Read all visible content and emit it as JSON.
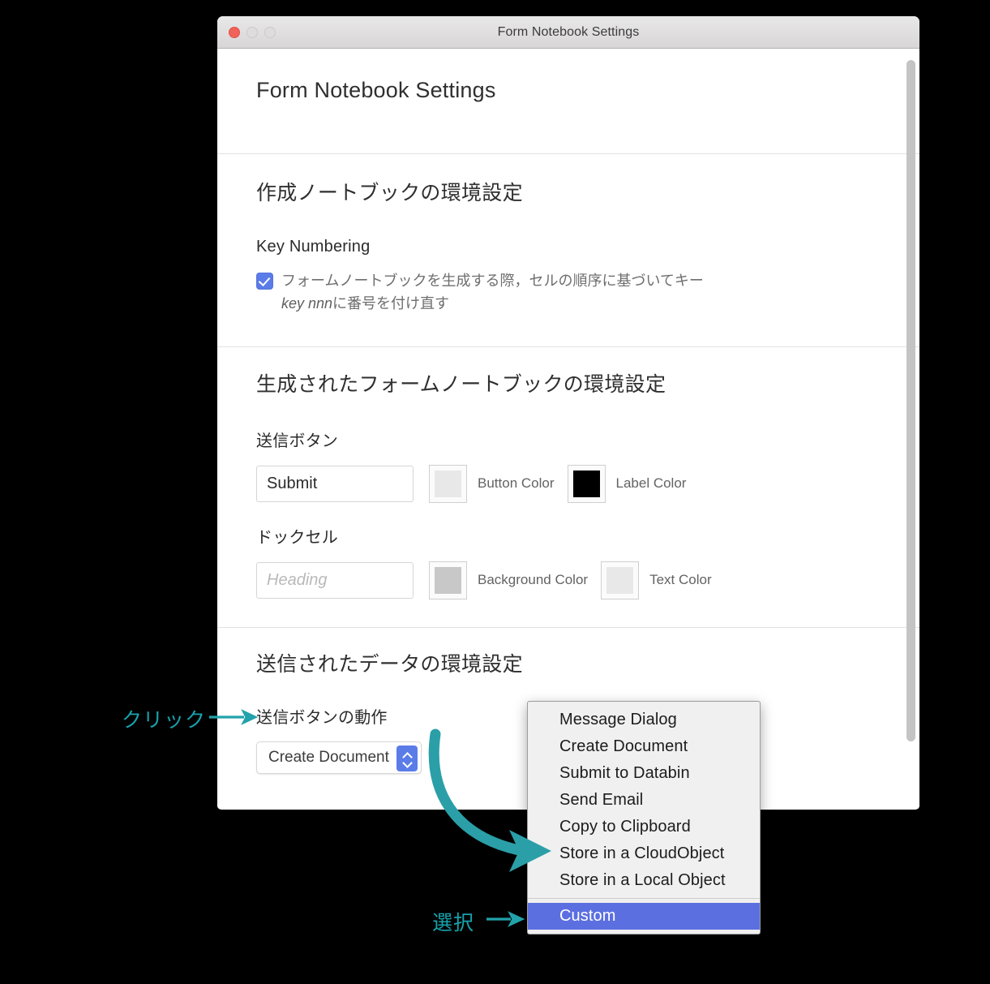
{
  "window": {
    "title": "Form Notebook Settings",
    "traffic_lights": [
      "close",
      "minimize",
      "zoom"
    ]
  },
  "page": {
    "title": "Form Notebook Settings"
  },
  "sections": [
    {
      "heading": "作成ノートブックの環境設定",
      "subheading": "Key Numbering",
      "checkbox": {
        "checked": true,
        "line1": "フォームノートブックを生成する際，セルの順序に基づいてキー",
        "line2_italic": "key nnn",
        "line2_rest": "に番号を付け直す"
      }
    },
    {
      "heading": "生成されたフォームノートブックの環境設定",
      "groups": [
        {
          "label": "送信ボタン",
          "field_value": "Submit",
          "field_placeholder": "",
          "swatches": [
            {
              "label": "Button Color",
              "color": "#e8e8e8"
            },
            {
              "label": "Label Color",
              "color": "#000000"
            }
          ]
        },
        {
          "label": "ドックセル",
          "field_value": "",
          "field_placeholder": "Heading",
          "swatches": [
            {
              "label": "Background Color",
              "color": "#c8c8c8"
            },
            {
              "label": "Text Color",
              "color": "#e8e8e8"
            }
          ]
        }
      ]
    },
    {
      "heading": "送信されたデータの環境設定",
      "subheading": "送信ボタンの動作",
      "popup_value": "Create Document"
    }
  ],
  "dropdown": {
    "items": [
      {
        "label": "Message Dialog",
        "selected": false
      },
      {
        "label": "Create Document",
        "selected": false
      },
      {
        "label": "Submit to Databin",
        "selected": false
      },
      {
        "label": "Send Email",
        "selected": false
      },
      {
        "label": "Copy to Clipboard",
        "selected": false
      },
      {
        "label": "Store in a CloudObject",
        "selected": false
      },
      {
        "label": "Store in a Local Object",
        "selected": false
      },
      {
        "label": "Custom",
        "selected": true
      }
    ],
    "separator_before_index": 7,
    "highlight_color": "#5b6fe0"
  },
  "annotations": {
    "click_label": "クリック",
    "select_label": "選択",
    "accent_color": "#17a3ad",
    "teal_arrow_color": "#2a9fa8"
  },
  "icons": {
    "stepper_up": "chevron-up-icon",
    "stepper_down": "chevron-down-icon",
    "checkmark": "check-icon"
  }
}
